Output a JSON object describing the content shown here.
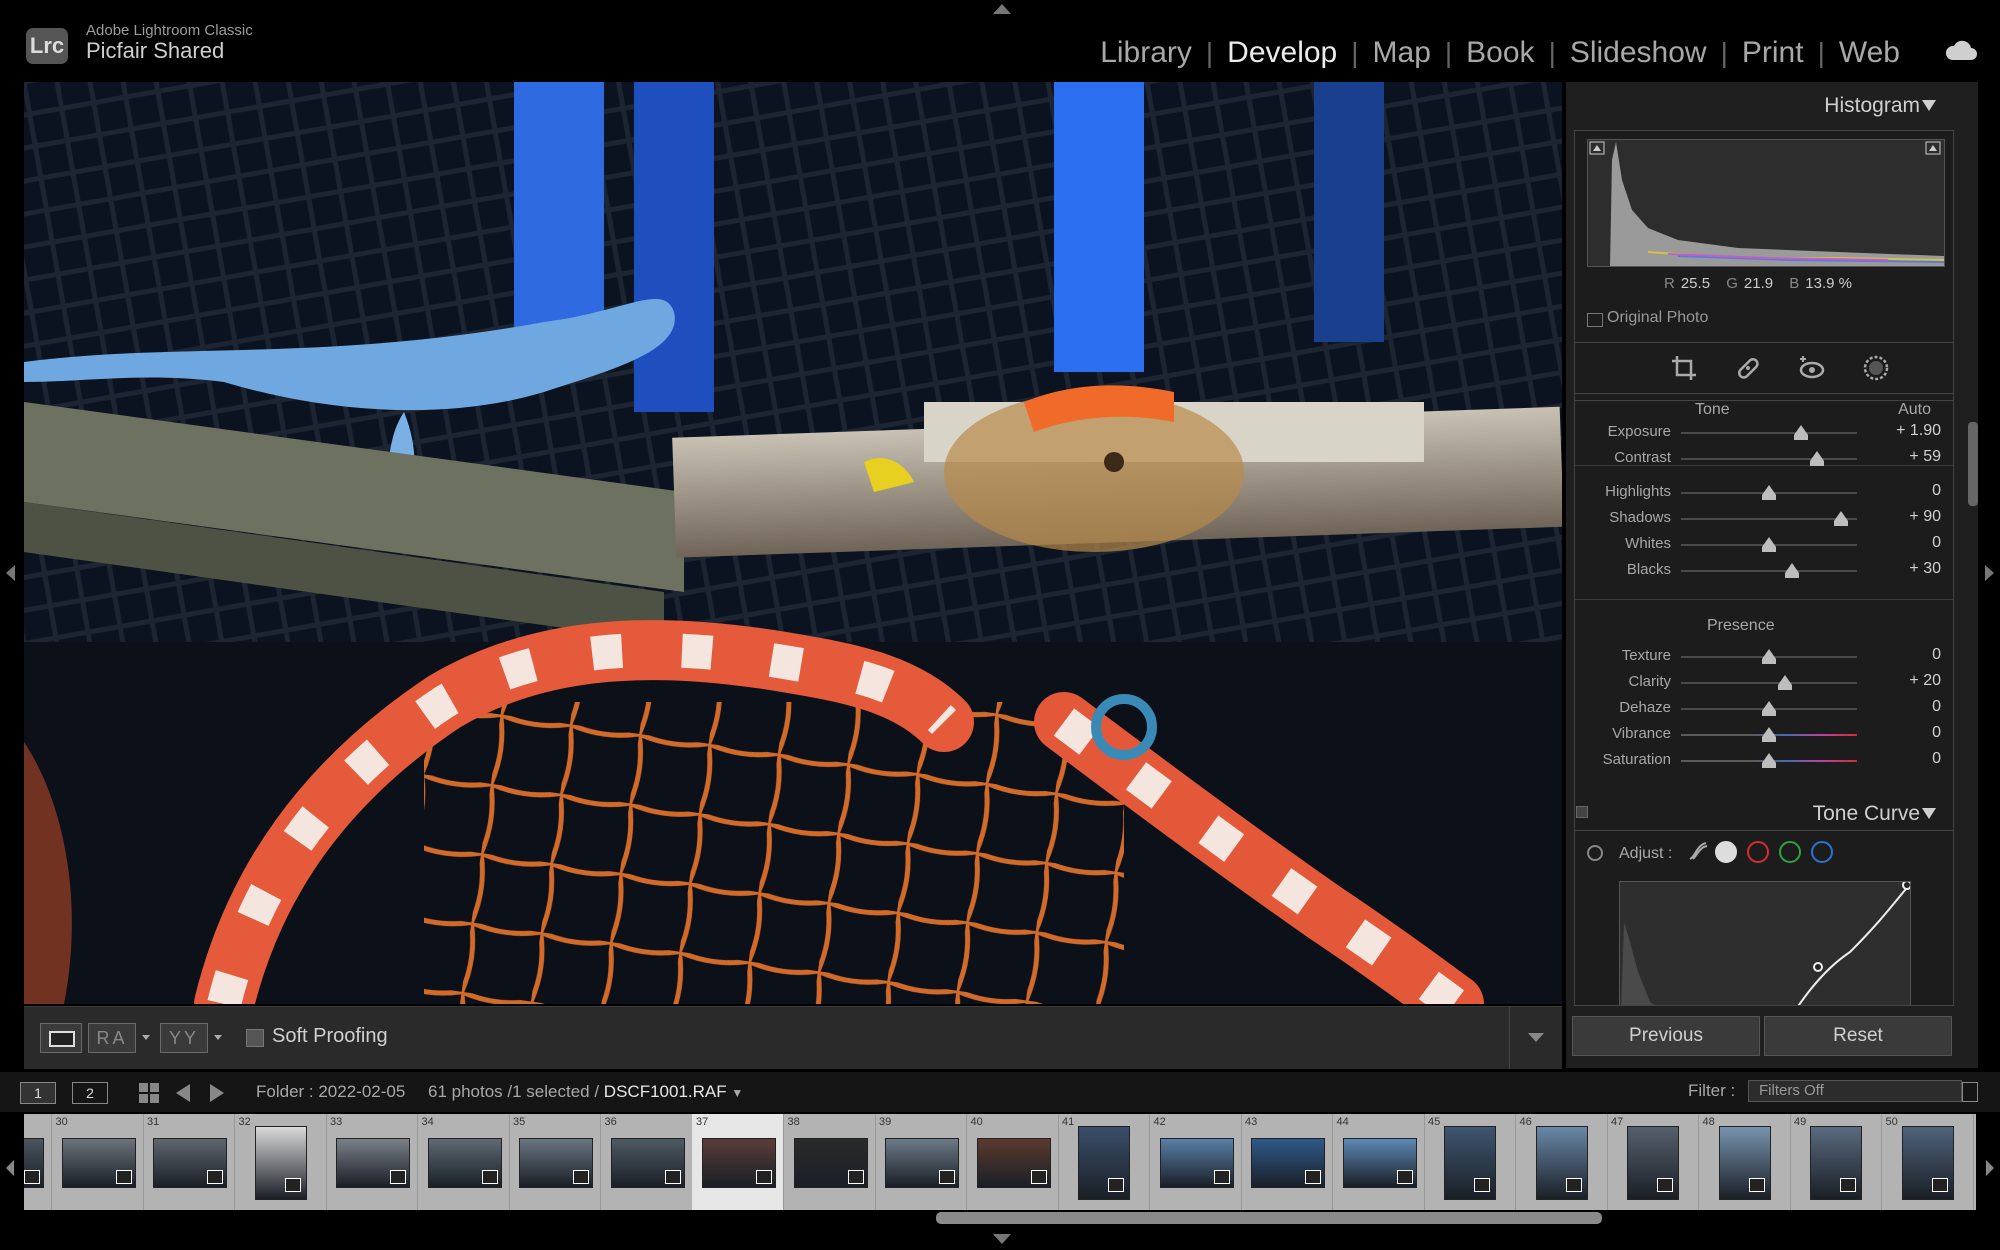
{
  "app": {
    "logo": "Lrc",
    "name": "Adobe Lightroom Classic",
    "catalog": "Picfair Shared"
  },
  "modules": [
    {
      "label": "Library",
      "active": false
    },
    {
      "label": "Develop",
      "active": true
    },
    {
      "label": "Map",
      "active": false
    },
    {
      "label": "Book",
      "active": false
    },
    {
      "label": "Slideshow",
      "active": false
    },
    {
      "label": "Print",
      "active": false
    },
    {
      "label": "Web",
      "active": false
    }
  ],
  "toolbar": {
    "ra_label": "RA",
    "yy_label": "YY",
    "soft_proofing": "Soft Proofing"
  },
  "histogram": {
    "title": "Histogram",
    "r_label": "R",
    "r": "25.5",
    "g_label": "G",
    "g": "21.9",
    "b_label": "B",
    "b": "13.9 %",
    "original_photo": "Original Photo"
  },
  "basic": {
    "tone_label": "Tone",
    "auto_label": "Auto",
    "presence_label": "Presence",
    "tone_sliders": [
      {
        "label": "Exposure",
        "value": "+ 1.90",
        "pos": 0.68
      },
      {
        "label": "Contrast",
        "value": "+ 59",
        "pos": 0.77
      }
    ],
    "hs_sliders": [
      {
        "label": "Highlights",
        "value": "0",
        "pos": 0.5
      },
      {
        "label": "Shadows",
        "value": "+ 90",
        "pos": 0.91
      },
      {
        "label": "Whites",
        "value": "0",
        "pos": 0.5
      },
      {
        "label": "Blacks",
        "value": "+ 30",
        "pos": 0.63
      }
    ],
    "presence_sliders": [
      {
        "label": "Texture",
        "value": "0",
        "pos": 0.5
      },
      {
        "label": "Clarity",
        "value": "+ 20",
        "pos": 0.59
      },
      {
        "label": "Dehaze",
        "value": "0",
        "pos": 0.5
      }
    ],
    "color_sliders": [
      {
        "label": "Vibrance",
        "value": "0",
        "pos": 0.5
      },
      {
        "label": "Saturation",
        "value": "0",
        "pos": 0.5
      }
    ]
  },
  "tone_curve": {
    "title": "Tone Curve",
    "adjust_label": "Adjust :"
  },
  "buttons": {
    "previous": "Previous",
    "reset": "Reset"
  },
  "filmstrip_bar": {
    "page1": "1",
    "page2": "2",
    "folder": "Folder : 2022-02-05",
    "count": "61 photos /1 selected /",
    "filename": "DSCF1001.RAF",
    "filter_label": "Filter :",
    "filter_value": "Filters Off"
  },
  "filmstrip": [
    {
      "num": "",
      "tone": "#4a5560"
    },
    {
      "num": "30",
      "tone": "#6b737c"
    },
    {
      "num": "31",
      "tone": "#5f666e"
    },
    {
      "num": "32",
      "tone": "#d9d9d9"
    },
    {
      "num": "33",
      "tone": "#7a8088"
    },
    {
      "num": "34",
      "tone": "#5e6a73"
    },
    {
      "num": "35",
      "tone": "#6a7682"
    },
    {
      "num": "36",
      "tone": "#4e5a64"
    },
    {
      "num": "37",
      "tone": "#5a3d38"
    },
    {
      "num": "38",
      "tone": "#2a2a2a"
    },
    {
      "num": "39",
      "tone": "#6d7a88"
    },
    {
      "num": "40",
      "tone": "#5b3a2e"
    },
    {
      "num": "41",
      "tone": "#3a4f6a"
    },
    {
      "num": "42",
      "tone": "#5a7fa8"
    },
    {
      "num": "43",
      "tone": "#2f5a8a"
    },
    {
      "num": "44",
      "tone": "#5d88b5"
    },
    {
      "num": "45",
      "tone": "#3e5670"
    },
    {
      "num": "46",
      "tone": "#6a88a8"
    },
    {
      "num": "47",
      "tone": "#56606c"
    },
    {
      "num": "48",
      "tone": "#7893ae"
    },
    {
      "num": "49",
      "tone": "#5a6a80"
    },
    {
      "num": "50",
      "tone": "#4f637a"
    }
  ]
}
